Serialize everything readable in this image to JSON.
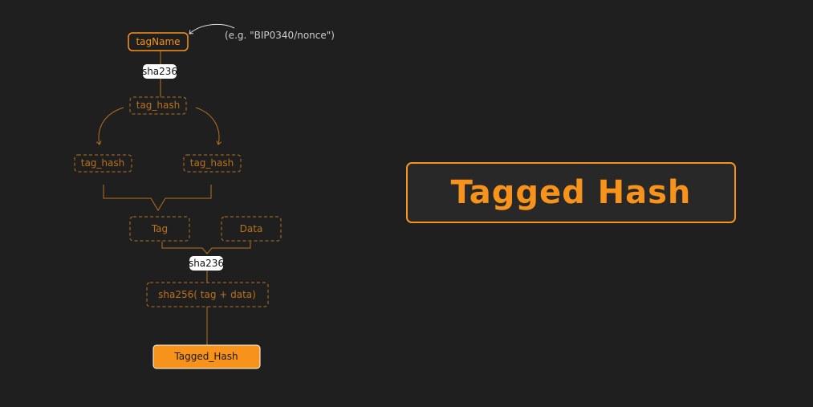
{
  "diagram": {
    "tag_name": "tagName",
    "example_note": "(e.g. \"BIP0340/nonce\")",
    "hash_badge_1": "sha236",
    "tag_hash_top": "tag_hash",
    "tag_hash_left": "tag_hash",
    "tag_hash_right": "tag_hash",
    "tag": "Tag",
    "data": "Data",
    "hash_badge_2": "sha236",
    "combined": "sha256( tag + data)",
    "result": "Tagged_Hash"
  },
  "title": "Tagged Hash",
  "colors": {
    "accent": "#f7931a",
    "background": "#1f1f1f",
    "muted_accent": "#b8711c"
  }
}
